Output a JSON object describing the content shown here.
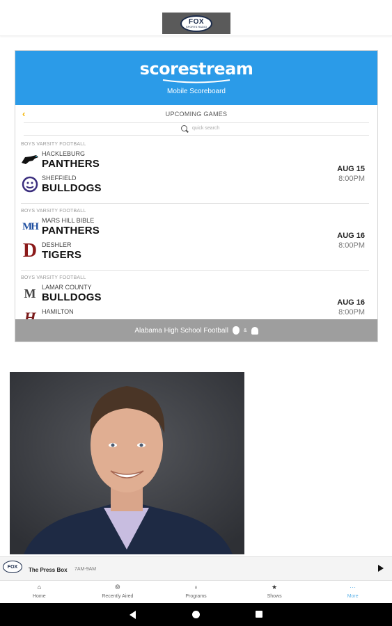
{
  "header": {
    "logo_top": "FOX",
    "logo_bottom": "SPORTS RADIO"
  },
  "widget": {
    "brand": "scorestream",
    "subtitle": "Mobile Scoreboard",
    "toolbar_title": "UPCOMING GAMES",
    "search_placeholder": "quick search",
    "games": [
      {
        "sport": "BOYS VARSITY FOOTBALL",
        "team1": {
          "city": "HACKLEBURG",
          "name": "PANTHERS",
          "logo_icon": "panther-logo-icon"
        },
        "team2": {
          "city": "SHEFFIELD",
          "name": "BULLDOGS",
          "logo_icon": "bulldog-logo-icon"
        },
        "date": "AUG 15",
        "time": "8:00PM"
      },
      {
        "sport": "BOYS VARSITY FOOTBALL",
        "team1": {
          "city": "MARS HILL BIBLE",
          "name": "PANTHERS",
          "logo_icon": "mh-logo-icon",
          "logo_text": "MH"
        },
        "team2": {
          "city": "DESHLER",
          "name": "TIGERS",
          "logo_icon": "d-logo-icon",
          "logo_text": "D"
        },
        "date": "AUG 16",
        "time": "8:00PM"
      },
      {
        "sport": "BOYS VARSITY FOOTBALL",
        "team1": {
          "city": "LAMAR COUNTY",
          "name": "BULLDOGS",
          "logo_icon": "m-logo-icon",
          "logo_text": "M"
        },
        "team2": {
          "city": "HAMILTON",
          "name": "",
          "logo_icon": "h-logo-icon",
          "logo_text": "H"
        },
        "date": "AUG 16",
        "time": "8:00PM"
      }
    ],
    "footer_text": "Alabama High School Football",
    "footer_and": "&",
    "colors": {
      "header_bg": "#2b9be8",
      "footer_bg": "#9e9e9e",
      "accent": "#f4b400"
    }
  },
  "now_playing": {
    "logo": "FOX",
    "title": "The Press Box",
    "time": "7AM-9AM"
  },
  "bottom_nav": [
    {
      "label": "Home",
      "icon": "home-icon",
      "glyph": "⌂"
    },
    {
      "label": "Recently Aired",
      "icon": "broadcast-icon",
      "glyph": "⦾"
    },
    {
      "label": "Programs",
      "icon": "microphone-icon",
      "glyph": "♁"
    },
    {
      "label": "Shows",
      "icon": "star-icon",
      "glyph": "★"
    },
    {
      "label": "More",
      "icon": "more-icon",
      "glyph": "···"
    }
  ]
}
